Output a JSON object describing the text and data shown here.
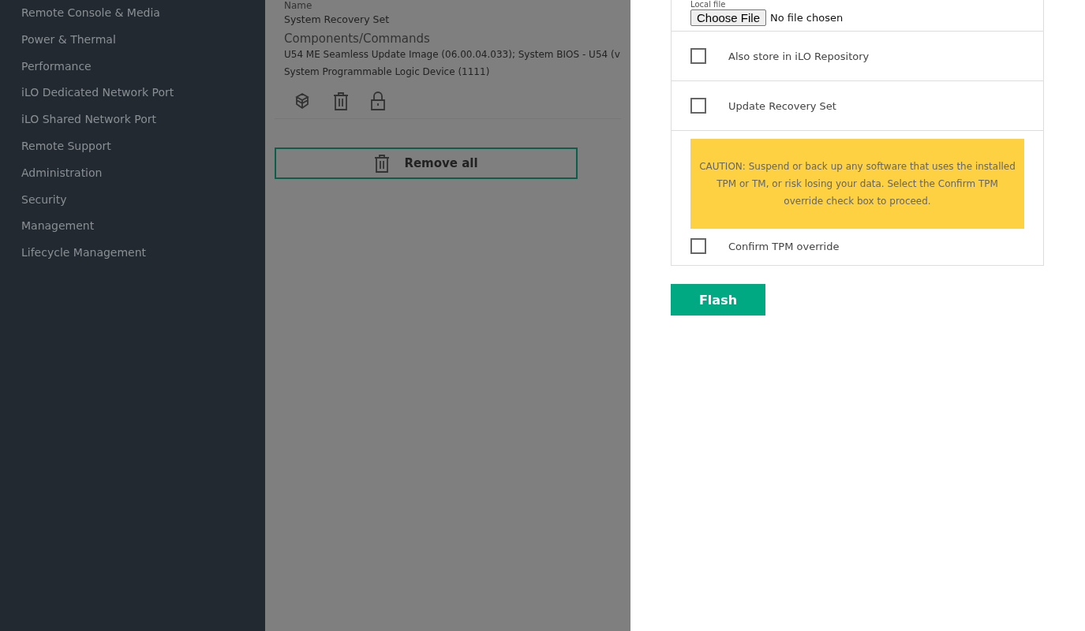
{
  "sidebar": {
    "items": [
      {
        "label": "Remote Console & Media"
      },
      {
        "label": "Power & Thermal"
      },
      {
        "label": "Performance"
      },
      {
        "label": "iLO Dedicated Network Port"
      },
      {
        "label": "iLO Shared Network Port"
      },
      {
        "label": "Remote Support"
      },
      {
        "label": "Administration"
      },
      {
        "label": "Security"
      },
      {
        "label": "Management"
      },
      {
        "label": "Lifecycle Management"
      }
    ]
  },
  "install_set": {
    "name_label": "Name",
    "name": "System Recovery Set",
    "components_label": "Components/Commands",
    "components": [
      "U54 ME Seamless Update Image (06.00.04.033); System BIOS - U54 (v",
      "System Programmable Logic Device (1111)"
    ],
    "remove_all": "Remove all"
  },
  "flash_panel": {
    "file_label": "Local file",
    "choose_button": "Choose File",
    "file_status": "No file chosen",
    "options": [
      {
        "label": "Also store in iLO Repository",
        "checked": false
      },
      {
        "label": "Update Recovery Set",
        "checked": false
      }
    ],
    "caution": "CAUTION: Suspend or back up any software that uses the installed TPM or TM, or risk losing your data. Select the Confirm TPM override check box to proceed.",
    "confirm": {
      "label": "Confirm TPM override",
      "checked": false
    },
    "flash_button": "Flash"
  }
}
